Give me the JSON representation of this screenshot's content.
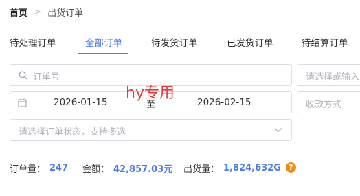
{
  "breadcrumb": {
    "home": "首页",
    "separator": ">",
    "current": "出货订单"
  },
  "tabs": [
    {
      "label": "待处理订单",
      "active": false
    },
    {
      "label": "全部订单",
      "active": true
    },
    {
      "label": "待发货订单",
      "active": false
    },
    {
      "label": "已发货订单",
      "active": false
    },
    {
      "label": "待结算订单",
      "active": false
    }
  ],
  "filters": {
    "order_no_placeholder": "订单号",
    "right_select_placeholder": "请选择或输入",
    "date_start": "2026-01-15",
    "date_separator": "至",
    "date_end": "2026-02-15",
    "payment_placeholder": "收款方式",
    "status_placeholder": "请选择订单状态，支持多选"
  },
  "watermark": "hy专用",
  "stats": {
    "orders_label": "订单量：",
    "orders_value": "247",
    "amount_label": "金额：",
    "amount_value": "42,857.03元",
    "shipped_label": "出货量：",
    "shipped_value": "1,824,632G",
    "help_glyph": "?"
  },
  "colors": {
    "accent": "#4c7af0",
    "watermark": "#e33a3a",
    "help": "#f08c19"
  },
  "icons": [
    "search-icon",
    "calendar-icon",
    "chevron-down-icon",
    "help-icon"
  ]
}
